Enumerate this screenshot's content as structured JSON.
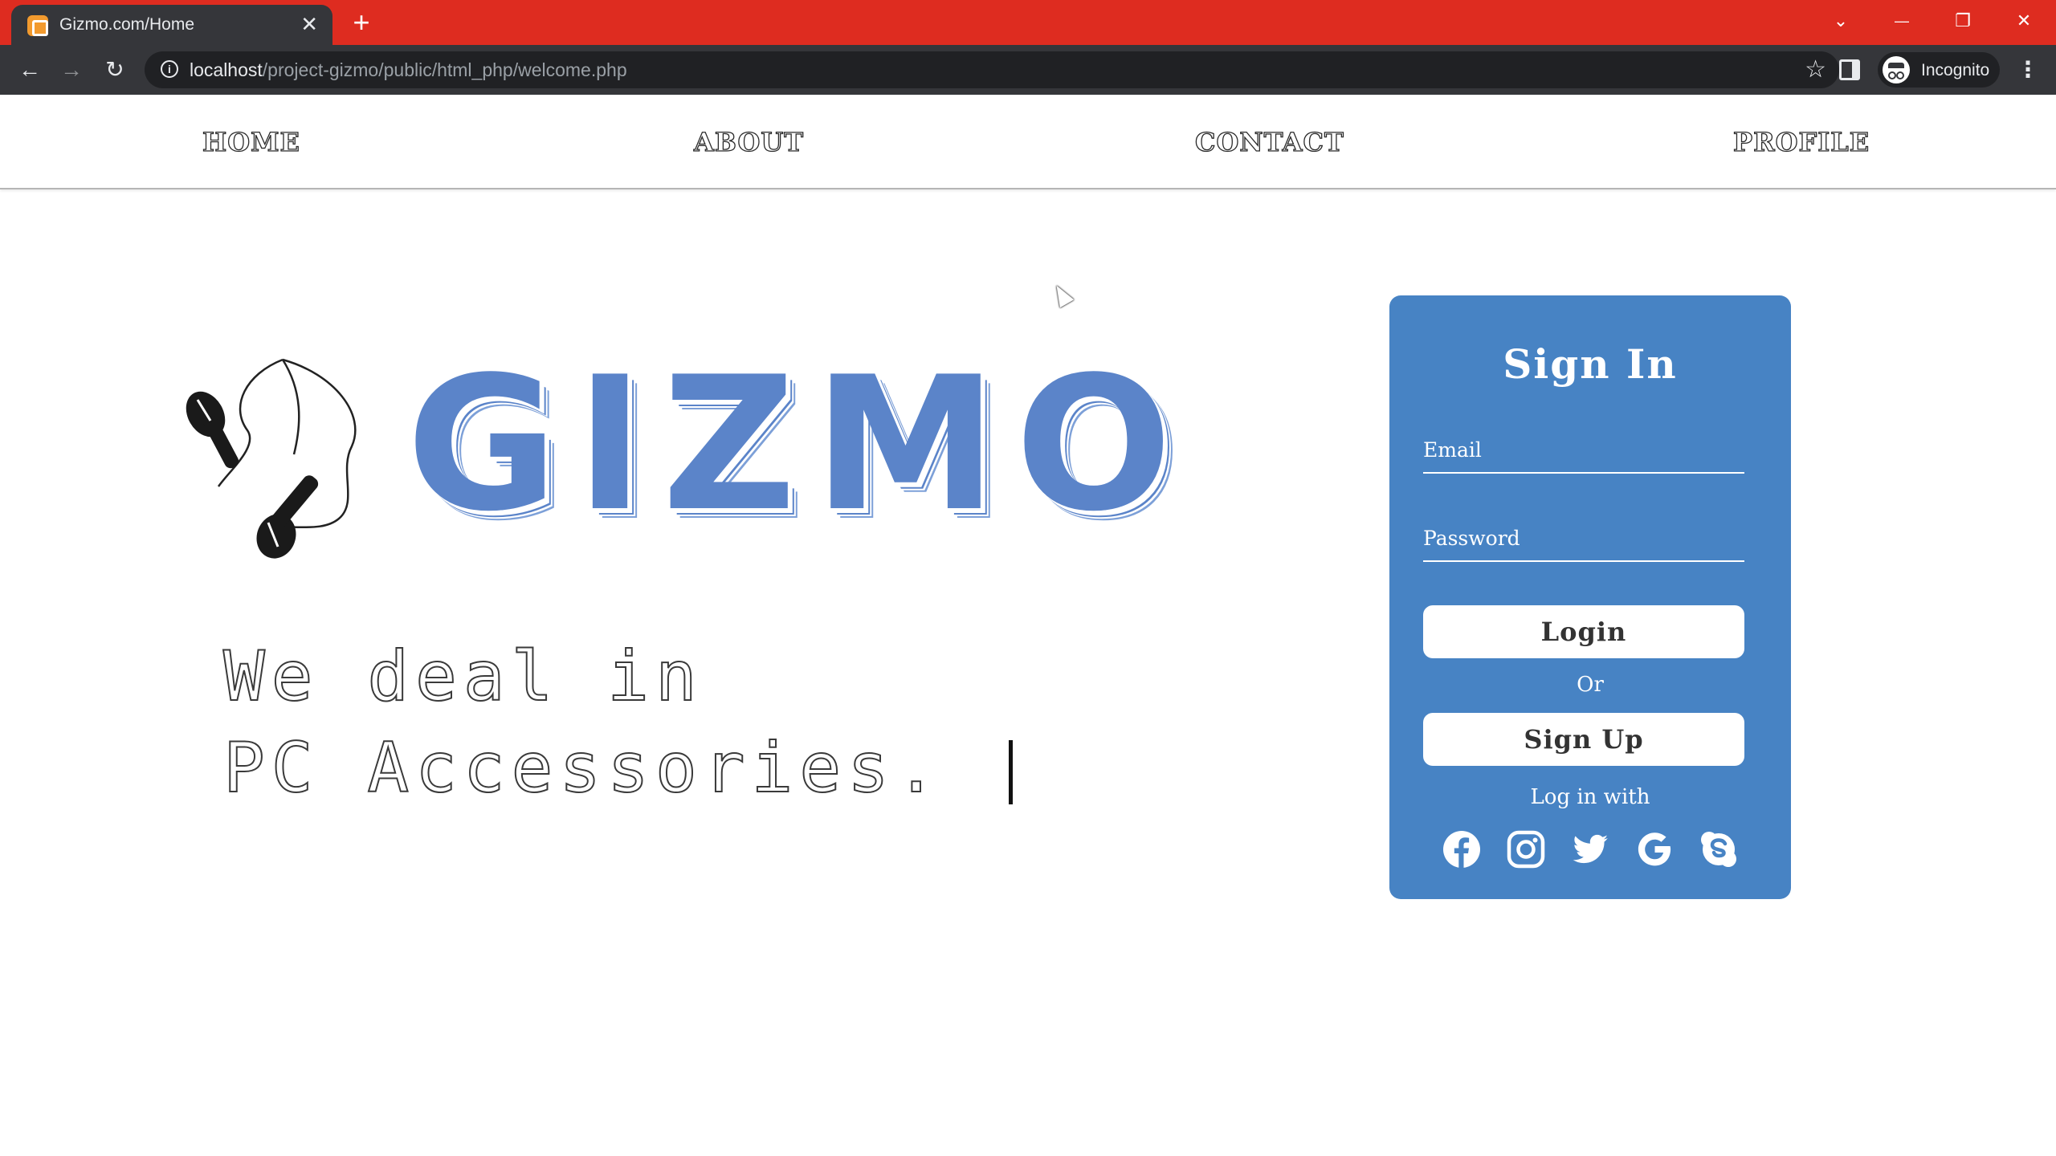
{
  "browser": {
    "tab_title": "Gizmo.com/Home",
    "tab_close": "✕",
    "new_tab": "+",
    "url_host": "localhost",
    "url_path": "/project-gizmo/public/html_php/welcome.php",
    "profile_label": "Incognito",
    "window_controls": {
      "dropdown": "⌄",
      "minimize": "—",
      "restore": "❐",
      "close": "✕"
    },
    "nav_icons": {
      "back": "←",
      "forward": "→",
      "reload": "↻",
      "star": "☆",
      "menu": "⋮",
      "info": "i"
    },
    "colors": {
      "tabbar": "#de2c20",
      "toolbar": "#35363a"
    }
  },
  "nav": {
    "items": [
      {
        "label": "HOME"
      },
      {
        "label": "ABOUT"
      },
      {
        "label": "CONTACT"
      },
      {
        "label": "PROFILE"
      }
    ]
  },
  "hero": {
    "brand": "GIZMO",
    "tagline_line1": "We deal in",
    "tagline_line2": "PC Accessories.",
    "brand_color": "#5b84c9"
  },
  "signin": {
    "title": "Sign In",
    "email_label": "Email",
    "password_label": "Password",
    "login_label": "Login",
    "or_text": "Or",
    "signup_label": "Sign Up",
    "login_with_text": "Log in with",
    "social_icons": [
      "facebook-icon",
      "instagram-icon",
      "twitter-icon",
      "google-icon",
      "skype-icon"
    ],
    "card_color": "#4783c4"
  }
}
